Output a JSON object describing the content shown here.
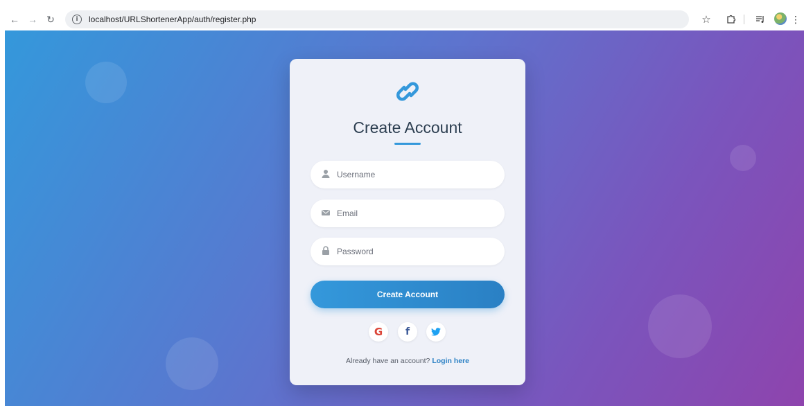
{
  "browser": {
    "url": "localhost/URLShortenerApp/auth/register.php",
    "icons": {
      "back": "arrow-left-icon",
      "forward": "arrow-right-icon",
      "reload": "reload-icon",
      "site_info": "info-icon",
      "bookmark": "star-icon",
      "extensions": "puzzle-icon",
      "media": "media-control-icon",
      "profile": "avatar",
      "menu": "kebab-menu-icon"
    }
  },
  "card": {
    "title": "Create Account",
    "logo_icon": "link-icon",
    "fields": {
      "username": {
        "placeholder": "Username",
        "value": "",
        "icon": "user-icon"
      },
      "email": {
        "placeholder": "Email",
        "value": "",
        "icon": "envelope-icon"
      },
      "password": {
        "placeholder": "Password",
        "value": "",
        "icon": "lock-icon"
      }
    },
    "submit_label": "Create Account",
    "social": {
      "google_glyph": "G",
      "facebook_glyph": "f",
      "twitter_icon": "twitter-bird-icon"
    },
    "login_prompt": "Already have an account?",
    "login_link": "Login here"
  },
  "colors": {
    "accent": "#3498db",
    "gradient_start": "#3498db",
    "gradient_end": "#8e44ad",
    "title": "#2c3e50",
    "google": "#db4437",
    "facebook": "#3b5998",
    "twitter": "#1da1f2"
  }
}
